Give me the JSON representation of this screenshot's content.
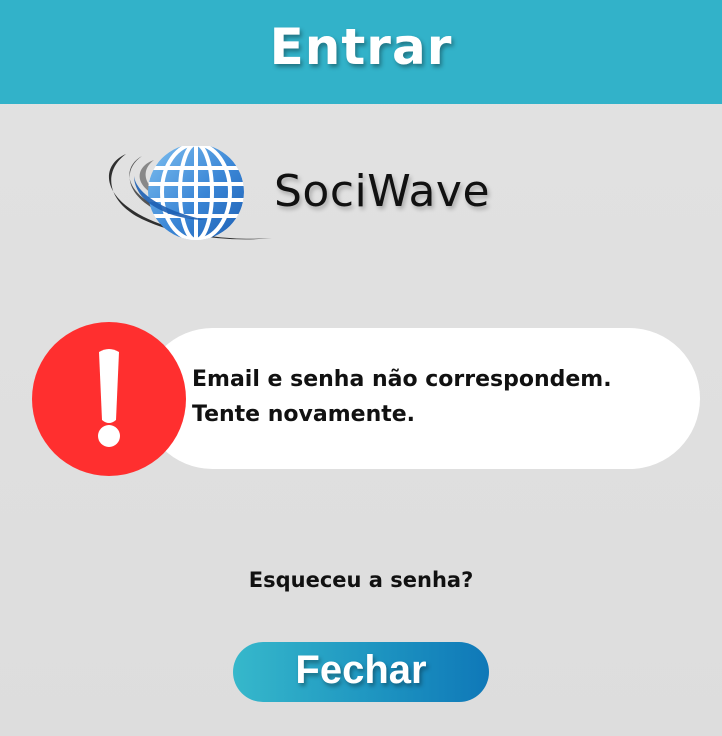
{
  "header": {
    "title": "Entrar",
    "color": "#32b2c9"
  },
  "brand": {
    "name": "SociWave",
    "logo_icon": "globe-swoosh-icon"
  },
  "alert": {
    "icon": "exclamation-icon",
    "icon_color": "#ff2f2f",
    "line1": "Email e senha não correspondem.",
    "line2": "Tente novamente."
  },
  "forgot_password": {
    "label": "Esqueceu a senha?"
  },
  "close_button": {
    "label": "Fechar"
  }
}
